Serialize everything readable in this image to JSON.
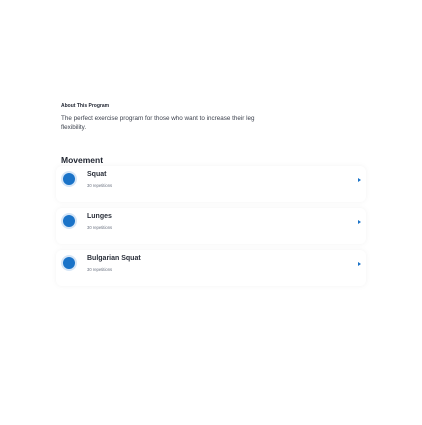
{
  "about": {
    "title": "About This Program",
    "description": "The perfect exercise program for those who want to increase their leg flexibility."
  },
  "section": {
    "title": "Movement"
  },
  "exercises": [
    {
      "name": "Squat",
      "reps": "30 repetitions"
    },
    {
      "name": "Lunges",
      "reps": "30 repetitions"
    },
    {
      "name": "Bulgarian Squat",
      "reps": "30 repetitions"
    }
  ],
  "icons": {
    "exercise": "circle-dot-icon",
    "chevron": "chevron-right-icon"
  },
  "colors": {
    "accent": "#1a73c8",
    "text": "#1f2430",
    "muted": "#6b7280"
  }
}
